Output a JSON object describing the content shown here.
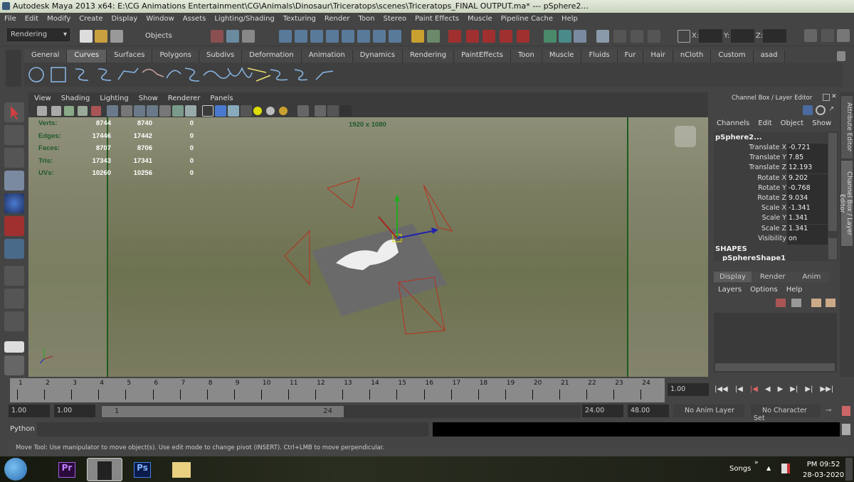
{
  "window": {
    "title": "Autodesk Maya 2013 x64: E:\\CG Animations Entertainment\\CG\\Animals\\Dinosaur\\Triceratops\\scenes\\Triceratops_FINAL OUTPUT.ma*   ---   pSphere2..."
  },
  "menu": [
    "File",
    "Edit",
    "Modify",
    "Create",
    "Display",
    "Window",
    "Assets",
    "Lighting/Shading",
    "Texturing",
    "Render",
    "Toon",
    "Stereo",
    "Paint Effects",
    "Muscle",
    "Pipeline Cache",
    "Help"
  ],
  "statusline": {
    "menuset": "Rendering",
    "selection_mode": "Objects",
    "x_label": "X:",
    "y_label": "Y:",
    "z_label": "Z:",
    "x": "",
    "y": "",
    "z": ""
  },
  "shelf": {
    "tabs": [
      "General",
      "Curves",
      "Surfaces",
      "Polygons",
      "Subdivs",
      "Deformation",
      "Animation",
      "Dynamics",
      "Rendering",
      "PaintEffects",
      "Toon",
      "Muscle",
      "Fluids",
      "Fur",
      "Hair",
      "nCloth",
      "Custom",
      "asad"
    ],
    "active": "Curves"
  },
  "panel": {
    "menu": [
      "View",
      "Shading",
      "Lighting",
      "Show",
      "Renderer",
      "Panels"
    ],
    "hud": {
      "rows": [
        {
          "label": "Verts:",
          "a": "8744",
          "b": "8740",
          "c": "0"
        },
        {
          "label": "Edges:",
          "a": "17446",
          "b": "17442",
          "c": "0"
        },
        {
          "label": "Faces:",
          "a": "8707",
          "b": "8706",
          "c": "0"
        },
        {
          "label": "Tris:",
          "a": "17343",
          "b": "17341",
          "c": "0"
        },
        {
          "label": "UVs:",
          "a": "10260",
          "b": "10256",
          "c": "0"
        }
      ],
      "resolution": "1920 x 1080"
    }
  },
  "channelbox": {
    "title": "Channel Box / Layer Editor",
    "menu": [
      "Channels",
      "Edit",
      "Object",
      "Show"
    ],
    "object": "pSphere2...",
    "channels": [
      {
        "label": "Translate X",
        "value": "-0.721"
      },
      {
        "label": "Translate Y",
        "value": "7.85"
      },
      {
        "label": "Translate Z",
        "value": "12.193"
      },
      {
        "label": "Rotate X",
        "value": "9.202"
      },
      {
        "label": "Rotate Y",
        "value": "-0.768"
      },
      {
        "label": "Rotate Z",
        "value": "9.034"
      },
      {
        "label": "Scale X",
        "value": "-1.341"
      },
      {
        "label": "Scale Y",
        "value": "1.341"
      },
      {
        "label": "Scale Z",
        "value": "1.341"
      },
      {
        "label": "Visibility",
        "value": "on"
      }
    ],
    "shapes_header": "SHAPES",
    "shape": "pSphereShape1",
    "layer_tabs": [
      "Display",
      "Render",
      "Anim"
    ],
    "layer_menu": [
      "Layers",
      "Options",
      "Help"
    ]
  },
  "side_tabs": [
    "Attribute Editor",
    "Channel Box / Layer Editor"
  ],
  "timeline": {
    "ticks": [
      "1",
      "2",
      "3",
      "4",
      "5",
      "6",
      "7",
      "8",
      "9",
      "10",
      "11",
      "12",
      "13",
      "14",
      "15",
      "16",
      "17",
      "18",
      "19",
      "20",
      "21",
      "22",
      "23",
      "24"
    ],
    "current_frame": "1.00"
  },
  "range": {
    "start": "1.00",
    "playback_start": "1.00",
    "slider_start": "1",
    "slider_end": "24",
    "playback_end": "24.00",
    "end": "48.00",
    "anim_layer": "No Anim Layer",
    "character_set": "No Character Set"
  },
  "commandline": {
    "label": "Python",
    "value": ""
  },
  "helpline": "Move Tool: Use manipulator to move object(s). Use edit mode to change pivot (INSERT).  Ctrl+LMB to move perpendicular.",
  "taskbar": {
    "toolbar_label": "Songs",
    "time": "PM 09:52",
    "date": "28-03-2020",
    "apps": [
      "Pr",
      "Maya",
      "Ps",
      "Explorer"
    ]
  }
}
